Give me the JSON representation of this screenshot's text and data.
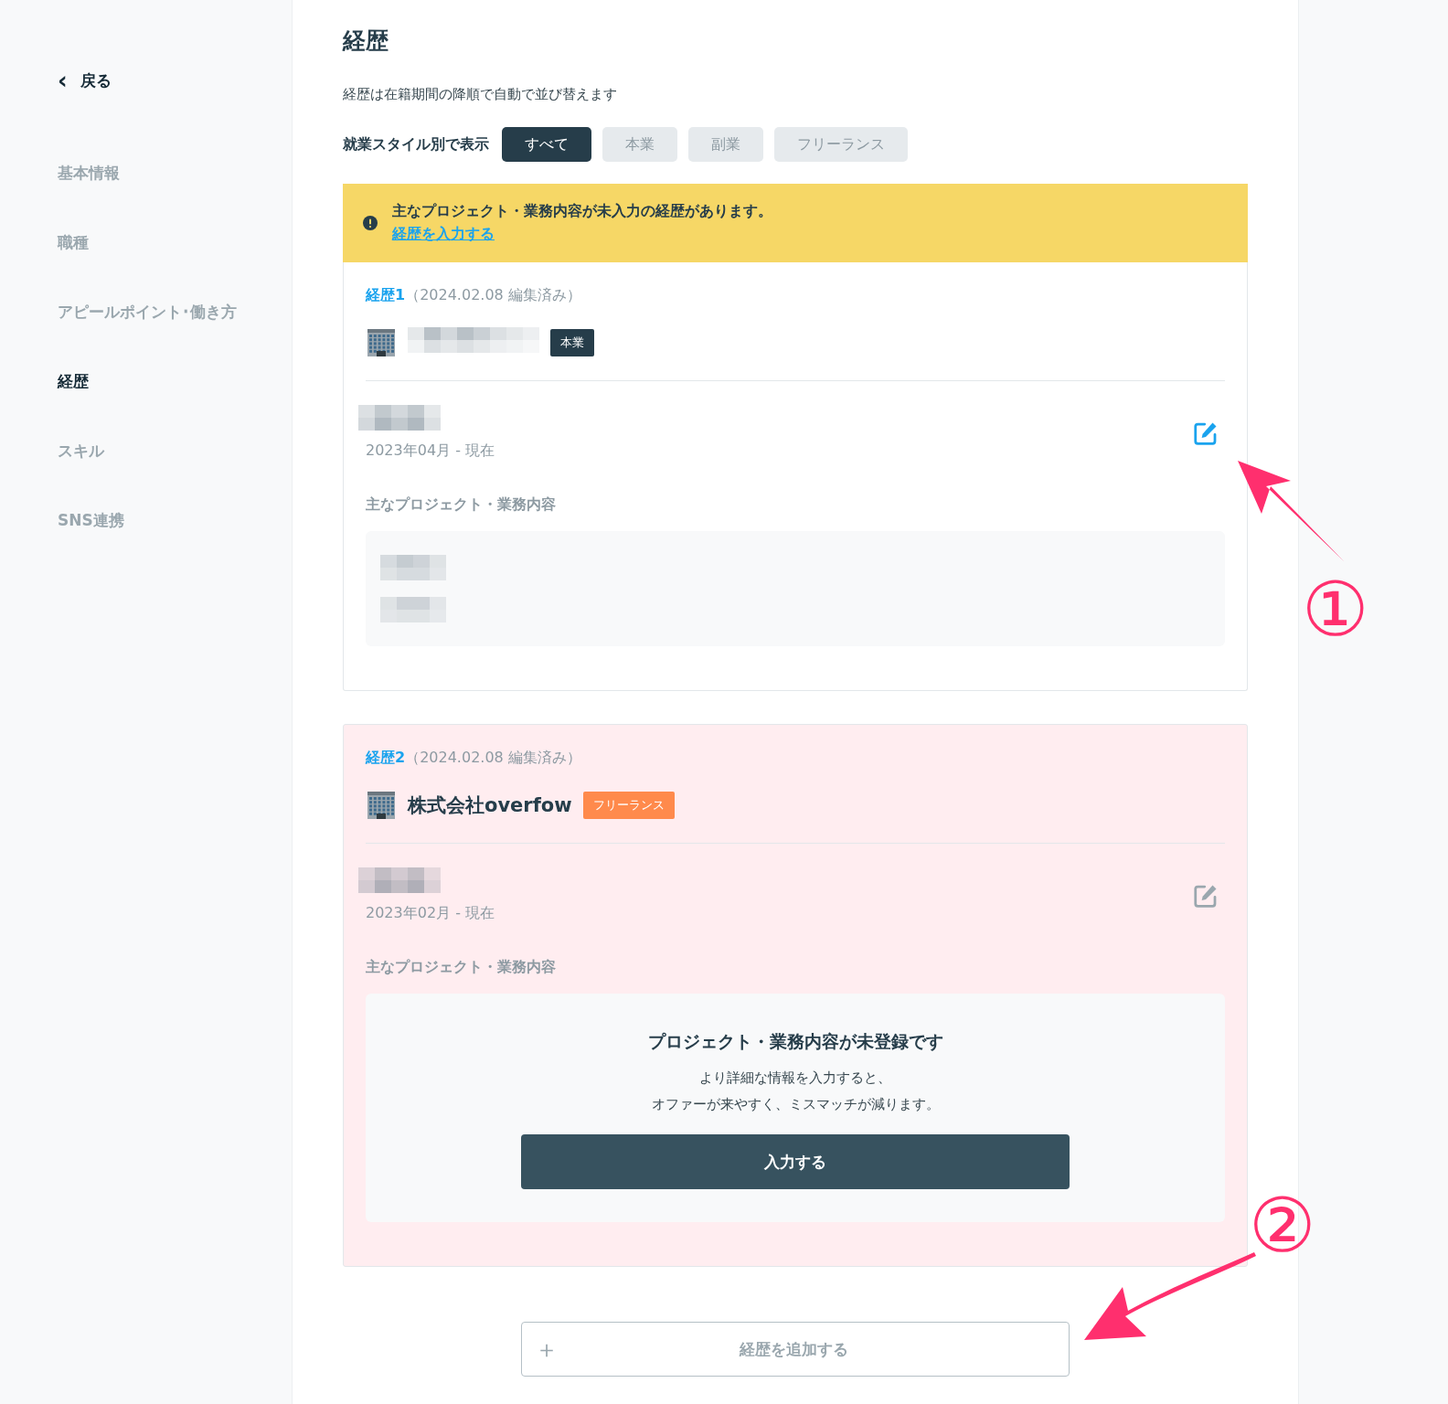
{
  "sidebar": {
    "back": {
      "icon": "‹",
      "label": "戻る"
    },
    "items": [
      {
        "label": "基本情報",
        "selected": false
      },
      {
        "label": "職種",
        "selected": false
      },
      {
        "label": "アピールポイント･働き方",
        "selected": false
      },
      {
        "label": "経歴",
        "selected": true
      },
      {
        "label": "スキル",
        "selected": false
      },
      {
        "label": "SNS連携",
        "selected": false
      }
    ]
  },
  "main": {
    "title": "経歴",
    "description": "経歴は在籍期間の降順で自動で並び替えます",
    "filter": {
      "label": "就業スタイル別で表示",
      "options": [
        {
          "label": "すべて",
          "selected": true
        },
        {
          "label": "本業",
          "selected": false
        },
        {
          "label": "副業",
          "selected": false
        },
        {
          "label": "フリーランス",
          "selected": false
        }
      ]
    },
    "alert": {
      "message": "主なプロジェクト・業務内容が未入力の経歴があります。",
      "link": "経歴を入力する"
    },
    "entries": [
      {
        "label": "経歴1",
        "meta": "（2024.02.08 編集済み）",
        "company": {
          "kind": "pixelated"
        },
        "badge": {
          "text": "本業",
          "color": "#263d4a"
        },
        "incomplete": false,
        "edit_highlighted": true,
        "period": "2023年04月 - 現在",
        "projects_label": "主なプロジェクト・業務内容",
        "projects": {
          "kind": "pixelated"
        }
      },
      {
        "label": "経歴2",
        "meta": "（2024.02.08 編集済み）",
        "company": {
          "kind": "text",
          "text": "株式会社overfow"
        },
        "badge": {
          "text": "フリーランス",
          "color": "#ff8a4c"
        },
        "incomplete": true,
        "edit_highlighted": false,
        "period": "2023年02月 - 現在",
        "projects_label": "主なプロジェクト・業務内容",
        "projects": {
          "kind": "empty",
          "title": "プロジェクト・業務内容が未登録です",
          "lines": [
            "より詳細な情報を入力すると、",
            "オファーが来やすく、ミスマッチが減ります。"
          ],
          "button": "入力する"
        }
      }
    ],
    "add_button": {
      "icon": "＋",
      "label": "経歴を追加する"
    }
  },
  "annotations": [
    {
      "number": "①"
    },
    {
      "number": "②"
    }
  ]
}
